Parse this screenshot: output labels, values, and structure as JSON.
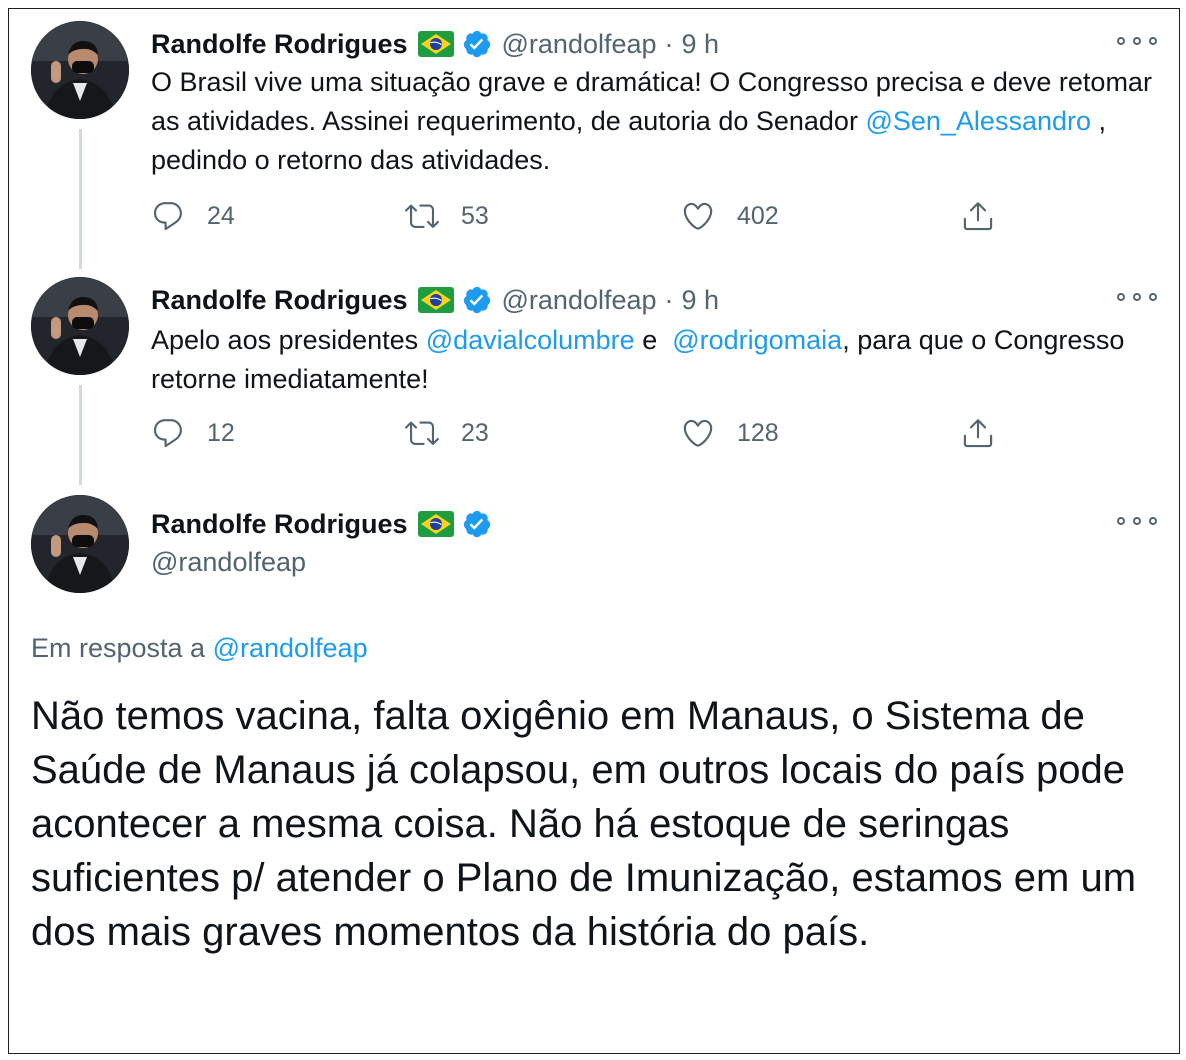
{
  "author": {
    "name": "Randolfe Rodrigues",
    "handle": "@randolfeap",
    "flag_icon": "brazil-flag-icon",
    "verified_icon": "verified-badge-icon"
  },
  "tweets": [
    {
      "time": "9 h",
      "dot": "·",
      "text_before": "O Brasil vive uma situação grave e dramática! O Congresso precisa e deve retomar as atividades. Assinei requerimento, de autoria do Senador ",
      "mention1": "@Sen_Alessandro",
      "text_after": " , pedindo o retorno das atividades.",
      "replies": "24",
      "retweets": "53",
      "likes": "402"
    },
    {
      "time": "9 h",
      "dot": "·",
      "text_before": "Apelo aos presidentes ",
      "mention1": "@davialcolumbre",
      "text_middle": " e  ",
      "mention2": "@rodrigomaia",
      "text_after": ", para que o Congresso retorne imediatamente!",
      "replies": "12",
      "retweets": "23",
      "likes": "128"
    }
  ],
  "focused": {
    "reply_label": "Em resposta a ",
    "reply_handle": "@randolfeap",
    "text": "Não temos vacina, falta oxigênio em Manaus, o Sistema de Saúde de Manaus já colapsou, em outros locais do país pode acontecer a mesma coisa. Não há estoque de seringas suficientes p/ atender o Plano de Imunização, estamos em um dos mais graves momentos da história do país."
  },
  "colors": {
    "link": "#1d9bf0",
    "secondary": "#536471",
    "text": "#0f1419",
    "thread_line": "#cfd9de"
  }
}
